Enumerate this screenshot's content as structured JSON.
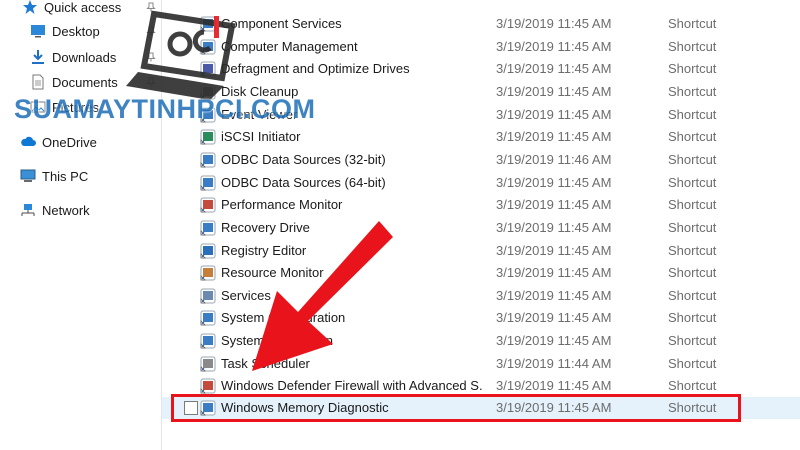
{
  "navigation": {
    "items": [
      {
        "label": "Quick access",
        "icon": "star-icon"
      },
      {
        "label": "Desktop",
        "icon": "desktop-icon"
      },
      {
        "label": "Downloads",
        "icon": "download-icon"
      },
      {
        "label": "Documents",
        "icon": "documents-icon"
      },
      {
        "label": "Pictures",
        "icon": "pictures-icon"
      },
      {
        "label": "OneDrive",
        "icon": "cloud-icon"
      },
      {
        "label": "This PC",
        "icon": "computer-icon"
      },
      {
        "label": "Network",
        "icon": "network-icon"
      }
    ]
  },
  "files": [
    {
      "name": "Component Services",
      "date": "3/19/2019 11:45 AM",
      "type": "Shortcut",
      "icon": "component-services-icon"
    },
    {
      "name": "Computer Management",
      "date": "3/19/2019 11:45 AM",
      "type": "Shortcut",
      "icon": "computer-management-icon"
    },
    {
      "name": "Defragment and Optimize Drives",
      "date": "3/19/2019 11:45 AM",
      "type": "Shortcut",
      "icon": "defragment-icon"
    },
    {
      "name": "Disk Cleanup",
      "date": "3/19/2019 11:45 AM",
      "type": "Shortcut",
      "icon": "disk-cleanup-icon"
    },
    {
      "name": "Event Viewer",
      "date": "3/19/2019 11:45 AM",
      "type": "Shortcut",
      "icon": "event-viewer-icon"
    },
    {
      "name": "iSCSI Initiator",
      "date": "3/19/2019 11:45 AM",
      "type": "Shortcut",
      "icon": "iscsi-icon"
    },
    {
      "name": "ODBC Data Sources (32-bit)",
      "date": "3/19/2019 11:46 AM",
      "type": "Shortcut",
      "icon": "odbc-icon"
    },
    {
      "name": "ODBC Data Sources (64-bit)",
      "date": "3/19/2019 11:45 AM",
      "type": "Shortcut",
      "icon": "odbc-icon"
    },
    {
      "name": "Performance Monitor",
      "date": "3/19/2019 11:45 AM",
      "type": "Shortcut",
      "icon": "performance-monitor-icon"
    },
    {
      "name": "Recovery Drive",
      "date": "3/19/2019 11:45 AM",
      "type": "Shortcut",
      "icon": "recovery-drive-icon"
    },
    {
      "name": "Registry Editor",
      "date": "3/19/2019 11:45 AM",
      "type": "Shortcut",
      "icon": "registry-editor-icon"
    },
    {
      "name": "Resource Monitor",
      "date": "3/19/2019 11:45 AM",
      "type": "Shortcut",
      "icon": "resource-monitor-icon"
    },
    {
      "name": "Services",
      "date": "3/19/2019 11:45 AM",
      "type": "Shortcut",
      "icon": "services-icon"
    },
    {
      "name": "System Configuration",
      "date": "3/19/2019 11:45 AM",
      "type": "Shortcut",
      "icon": "system-configuration-icon"
    },
    {
      "name": "System Information",
      "date": "3/19/2019 11:45 AM",
      "type": "Shortcut",
      "icon": "system-information-icon"
    },
    {
      "name": "Task Scheduler",
      "date": "3/19/2019 11:44 AM",
      "type": "Shortcut",
      "icon": "task-scheduler-icon"
    },
    {
      "name": "Windows Defender Firewall with Advanced S...",
      "date": "3/19/2019 11:45 AM",
      "type": "Shortcut",
      "icon": "firewall-icon"
    },
    {
      "name": "Windows Memory Diagnostic",
      "date": "3/19/2019 11:45 AM",
      "type": "Shortcut",
      "icon": "memory-diagnostic-icon",
      "selected": true
    }
  ],
  "watermark": {
    "text": "SUAMAYTINHPCI.COM",
    "logo": "pci"
  },
  "colors": {
    "accent": "#e8131b",
    "selection": "#e5f1fb",
    "link_blue": "#1e6fb8"
  }
}
